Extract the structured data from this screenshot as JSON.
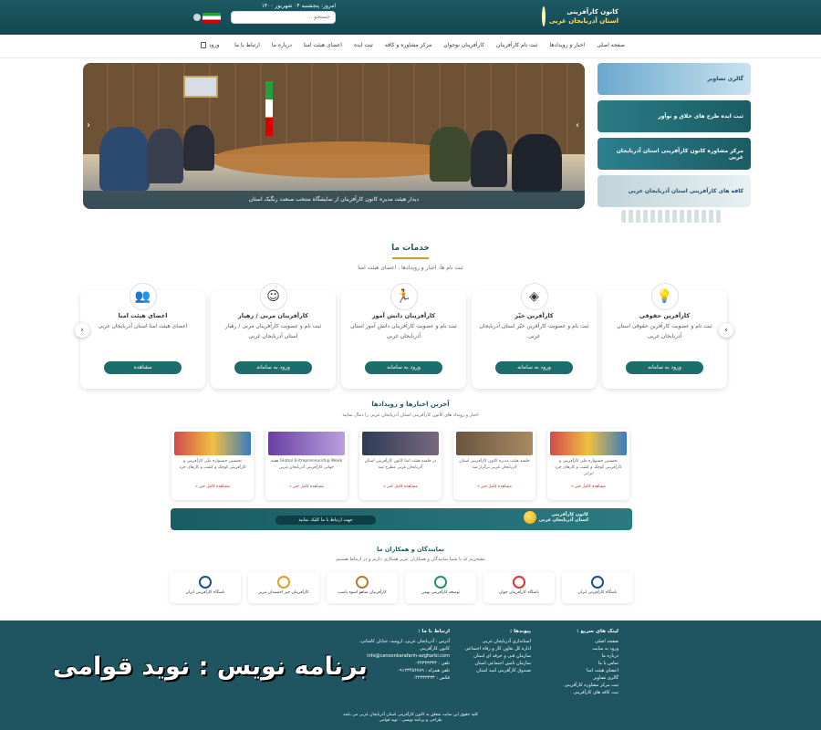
{
  "header": {
    "logo_line1": "کانون کارآفرینی",
    "logo_line2": "استان آذربایجان غربی",
    "date": "امروز: پنجشنبه ۰۴ شهریور ۱۴۰۰",
    "search_placeholder": "جستجو ..."
  },
  "nav": {
    "items": [
      "صفحه اصلی",
      "اخبار و رویدادها",
      "ثبت نام کارآفرینان",
      "کارآفرینان نوجوان",
      "مرکز مشاوره و کافه",
      "ثبت ایده",
      "اعضای هیئت امنا",
      "درباره ما",
      "ارتباط با ما"
    ],
    "login": "ورود"
  },
  "slider": {
    "caption": "دیدار هیئت مدیره کانون کارآفرینان از نمایشگاه منتخب صنعت رنگیک استان"
  },
  "side_banners": [
    {
      "label": "گالری تصاویر"
    },
    {
      "label": "ثبت ایده طرح های خلاق و نوآور"
    },
    {
      "label": "مرکز مشاوره کانون کارآفرینی استان آذربایجان غربی"
    },
    {
      "label": "کافه های کارآفرینی استان آذربایجان غربی"
    }
  ],
  "services": {
    "title": "خدمات ما",
    "subtitle": "ثبت نام ها، اخبار و رویدادها ، اعضای هیئت امنا",
    "cards": [
      {
        "title": "کارآفرین حقوقی",
        "desc": "ثبت نام و عضویت کارآفرین حقوقی استان آذربایجان غربی",
        "btn": "ورود به سامانه",
        "icon": "💡",
        "icon_name": "lightbulb-icon"
      },
      {
        "title": "کارآفرین خیّر",
        "desc": "ثبت نام و عضویت کارآفرین خیّر استان آذربایجان غربی",
        "btn": "ورود به سامانه",
        "icon": "◈",
        "icon_name": "diamond-icon"
      },
      {
        "title": "کارآفرینان دانش آموز",
        "desc": "ثبت نام و عضویت کارآفرینان دانش آموز استان آذربایجان غربی",
        "btn": "ورود به سامانه",
        "icon": "🏃",
        "icon_name": "runner-icon"
      },
      {
        "title": "کارآفرینان مربی / رهبار",
        "desc": "ثبت نام و عضویت کارآفرینان مربی / رهبار استان آذربایجان غربی",
        "btn": "ورود به سامانه",
        "icon": "☺",
        "icon_name": "coach-icon"
      },
      {
        "title": "اعضای هیئت امنا",
        "desc": "اعضای هیئت امنا استان آذربایجان غربی",
        "btn": "مشاهده",
        "icon": "👥",
        "icon_name": "people-icon"
      }
    ]
  },
  "news": {
    "title": "آخرین اخبارها و رویدادها",
    "subtitle": "اخبار و رویداد های کانون کارآفرینی استان آذربایجان غربی را دنبال نمایید",
    "more": "مشاهده کامل خبر »",
    "items": [
      {
        "text": "نخستین جشنواره ملی کارآفرینی و کارآفرینی کوچک و کسب و کارهای خرد ایرانی"
      },
      {
        "text": "جلسه هیئت مدیره کانون کارآفرینی استان آذربایجان غربی برگزار شد"
      },
      {
        "text": "در جلسه هیئت امنا کانون کارآفرینی استان آذربایجان غربی مطرح شد"
      },
      {
        "text": "Global Entrepreneurship Week هفته جهانی کارآفرینی آذربایجان غربی"
      },
      {
        "text": "نخستین جشنواره ملی کارآفرینی و کارآفرینی کوچک و کسب و کارهای خرد"
      }
    ]
  },
  "cta": {
    "button": "جهت ارتباط با ما کلیک نمایید",
    "logo_line1": "کانون کارآفرینی",
    "logo_line2": "استان آذربایجان غربی"
  },
  "partners": {
    "title": "نمایندگان و همکاران ما",
    "subtitle": "مفتخریم که با شما نمایندگان و همکاران عزیز همکاری داریم و در ارتباط هستیم",
    "items": [
      {
        "name": "باشگاه کارآفرینی ایران"
      },
      {
        "name": "باشگاه کارآفرینان جوان"
      },
      {
        "name": "توسعه کارآفرینی بهمن"
      },
      {
        "name": "کارآفرینان شاهو اسوه پاسپ"
      },
      {
        "name": "کارآفرینان خیر اخشیدان تبریز"
      },
      {
        "name": "باشگاه کارآفرینی ایران"
      }
    ]
  },
  "footer": {
    "quick_title": "لینک های سریع :",
    "quick_links": [
      "صفحه اصلی",
      "ورود به سایت",
      "درباره ما",
      "تماس با ما",
      "اعضای هیئت امنا",
      "گالری تصاویر",
      "ثبت مرکز مشاوره کارآفرینی",
      "ثبت کافه های کارآفرینی"
    ],
    "links_title": "پیوندها :",
    "links": [
      "استانداری آذربایجان غربی",
      "اداره کل تعاون کار و رفاه اجتماعی",
      "سازمان فنی و حرفه ای استان",
      "سازمان تامین اجتماعی استان",
      "صندوق کارآفرینی امید استان"
    ],
    "contact_title": "ارتباط با ما :",
    "contact": [
      "آدرس : آذربایجان غربی، ارومیه، خیابان کاشانی، کانون کارآفرینی",
      "info@canoonkarafarin-azgharbi.com",
      "تلفن : ۰۴۴۳۳۳۳۳۳",
      "تلفن همراه : ۰۹۱۲۳۴۵۶۷۸۹",
      "فکس : ۰۴۴۳۳۳۳۳۳"
    ],
    "watermark": "برنامه نویس : نوید قوامی",
    "copyright1": "کلیه حقوق این سایت متعلق به کانون کارآفرینی استان آذربایجان غربی می باشد",
    "copyright2": "طراحی و برنامه نویسی : نوید قوامی"
  }
}
